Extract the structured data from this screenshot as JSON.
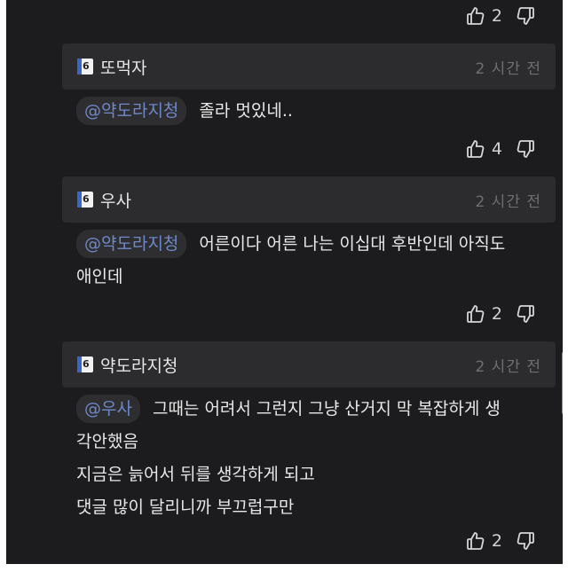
{
  "comments": [
    {
      "author": "또먹자",
      "time": "2 시간 전",
      "mention": "@약도라지청",
      "text": "졸라 멋있네..",
      "likes": "4"
    },
    {
      "author": "우사",
      "time": "2 시간 전",
      "mention": "@약도라지청",
      "text": "어른이다 어른 나는 이십대 후반인데 아직도\n애인데",
      "likes": "2"
    },
    {
      "author": "약도라지청",
      "time": "2 시간 전",
      "mention": "@우사",
      "text": "그때는 어려서 그런지 그냥 산거지 막 복잡하게 생\n각안했음\n지금은 늙어서 뒤를 생각하게 되고\n댓글 많이 달리니까 부끄럽구만",
      "likes": "2"
    }
  ],
  "top_votes": {
    "likes": "2"
  },
  "icons": {
    "like": "thumbs-up-icon",
    "dislike": "thumbs-down-icon",
    "badge": "user-badge-icon"
  },
  "colors": {
    "background": "#1c1c1e",
    "header": "#2c2c2e",
    "mention": "#6f88c9",
    "text": "#e8e8e8"
  }
}
